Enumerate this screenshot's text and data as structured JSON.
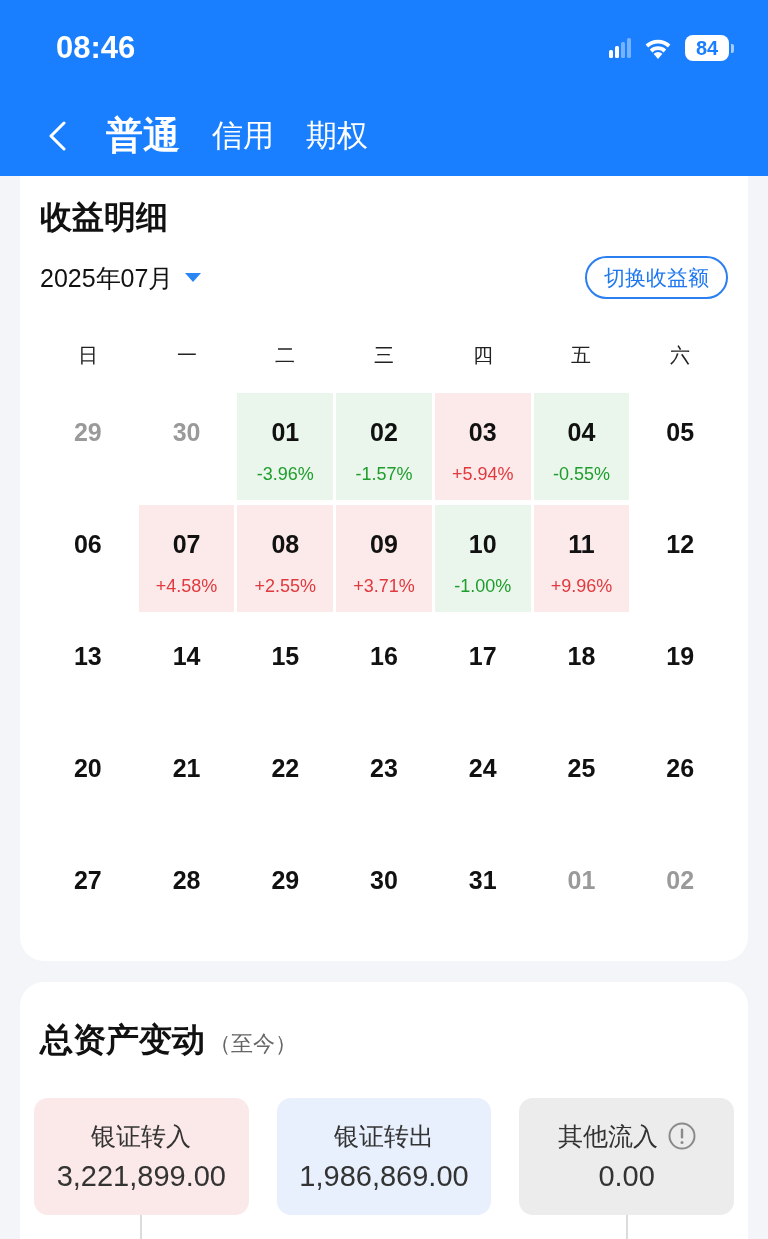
{
  "status_bar": {
    "time": "08:46",
    "battery": "84"
  },
  "nav": {
    "tabs": [
      {
        "label": "普通",
        "selected": true
      },
      {
        "label": "信用",
        "selected": false
      },
      {
        "label": "期权",
        "selected": false
      }
    ]
  },
  "earnings": {
    "title": "收益明细",
    "month": "2025年07月",
    "toggle_button": "切换收益额",
    "weekdays": [
      "日",
      "一",
      "二",
      "三",
      "四",
      "五",
      "六"
    ],
    "weeks": [
      [
        {
          "day": "29",
          "other_month": true,
          "kind": "plain"
        },
        {
          "day": "30",
          "other_month": true,
          "kind": "plain"
        },
        {
          "day": "01",
          "other_month": false,
          "kind": "loss",
          "change": "-3.96%"
        },
        {
          "day": "02",
          "other_month": false,
          "kind": "loss",
          "change": "-1.57%"
        },
        {
          "day": "03",
          "other_month": false,
          "kind": "gain",
          "change": "+5.94%"
        },
        {
          "day": "04",
          "other_month": false,
          "kind": "loss",
          "change": "-0.55%"
        },
        {
          "day": "05",
          "other_month": false,
          "kind": "plain"
        }
      ],
      [
        {
          "day": "06",
          "other_month": false,
          "kind": "plain"
        },
        {
          "day": "07",
          "other_month": false,
          "kind": "gain",
          "change": "+4.58%"
        },
        {
          "day": "08",
          "other_month": false,
          "kind": "gain",
          "change": "+2.55%"
        },
        {
          "day": "09",
          "other_month": false,
          "kind": "gain",
          "change": "+3.71%"
        },
        {
          "day": "10",
          "other_month": false,
          "kind": "loss",
          "change": "-1.00%"
        },
        {
          "day": "11",
          "other_month": false,
          "kind": "gain",
          "change": "+9.96%"
        },
        {
          "day": "12",
          "other_month": false,
          "kind": "plain"
        }
      ],
      [
        {
          "day": "13",
          "other_month": false,
          "kind": "plain"
        },
        {
          "day": "14",
          "other_month": false,
          "kind": "plain"
        },
        {
          "day": "15",
          "other_month": false,
          "kind": "plain"
        },
        {
          "day": "16",
          "other_month": false,
          "kind": "plain"
        },
        {
          "day": "17",
          "other_month": false,
          "kind": "plain"
        },
        {
          "day": "18",
          "other_month": false,
          "kind": "plain"
        },
        {
          "day": "19",
          "other_month": false,
          "kind": "plain"
        }
      ],
      [
        {
          "day": "20",
          "other_month": false,
          "kind": "plain"
        },
        {
          "day": "21",
          "other_month": false,
          "kind": "plain"
        },
        {
          "day": "22",
          "other_month": false,
          "kind": "plain"
        },
        {
          "day": "23",
          "other_month": false,
          "kind": "plain"
        },
        {
          "day": "24",
          "other_month": false,
          "kind": "plain"
        },
        {
          "day": "25",
          "other_month": false,
          "kind": "plain"
        },
        {
          "day": "26",
          "other_month": false,
          "kind": "plain"
        }
      ],
      [
        {
          "day": "27",
          "other_month": false,
          "kind": "plain"
        },
        {
          "day": "28",
          "other_month": false,
          "kind": "plain"
        },
        {
          "day": "29",
          "other_month": false,
          "kind": "plain"
        },
        {
          "day": "30",
          "other_month": false,
          "kind": "plain"
        },
        {
          "day": "31",
          "other_month": false,
          "kind": "plain"
        },
        {
          "day": "01",
          "other_month": true,
          "kind": "plain"
        },
        {
          "day": "02",
          "other_month": true,
          "kind": "plain"
        }
      ]
    ]
  },
  "asset_changes": {
    "title": "总资产变动",
    "subtitle": "（至今）",
    "tiles": [
      {
        "label": "银证转入",
        "value": "3,221,899.00",
        "color": "#fbe8e8",
        "info": false,
        "connector": true
      },
      {
        "label": "银证转出",
        "value": "1,986,869.00",
        "color": "#e8f0fd",
        "info": false,
        "connector": false
      },
      {
        "label": "其他流入",
        "value": "0.00",
        "color": "#ececec",
        "info": true,
        "connector": true
      }
    ]
  }
}
